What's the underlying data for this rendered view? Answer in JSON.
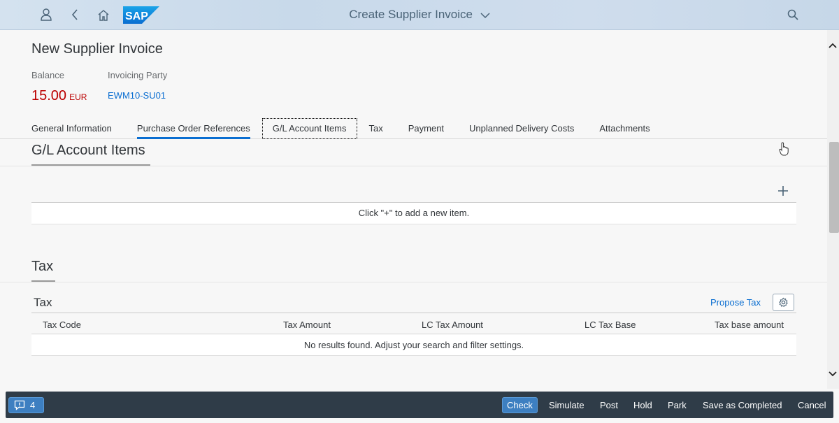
{
  "shell": {
    "app_title": "Create Supplier Invoice",
    "logo_text": "SAP",
    "icons": [
      "user-icon",
      "back-icon",
      "home-icon",
      "search-icon"
    ]
  },
  "header": {
    "page_title": "New Supplier Invoice",
    "balance_label": "Balance",
    "balance_value": "15.00",
    "balance_currency": "EUR",
    "party_label": "Invoicing Party",
    "party_value": "EWM10-SU01"
  },
  "tabs": [
    {
      "label": "General Information"
    },
    {
      "label": "Purchase Order References"
    },
    {
      "label": "G/L Account Items"
    },
    {
      "label": "Tax"
    },
    {
      "label": "Payment"
    },
    {
      "label": "Unplanned Delivery Costs"
    },
    {
      "label": "Attachments"
    }
  ],
  "gl_section": {
    "title": "G/L Account Items",
    "empty_text": "Click \"+\" to add a new item."
  },
  "tax_section": {
    "title": "Tax",
    "toolbar_title": "Tax",
    "propose_label": "Propose Tax",
    "columns": [
      "Tax Code",
      "Tax Amount",
      "LC Tax Amount",
      "LC Tax Base",
      "Tax base amount"
    ],
    "empty_text": "No results found. Adjust your search and filter settings."
  },
  "footer": {
    "message_count": "4",
    "buttons": [
      "Check",
      "Simulate",
      "Post",
      "Hold",
      "Park",
      "Save as Completed",
      "Cancel"
    ]
  },
  "colors": {
    "accent": "#0a6ed1",
    "negative": "#bb0000",
    "footer_bg": "#2f3c48"
  }
}
